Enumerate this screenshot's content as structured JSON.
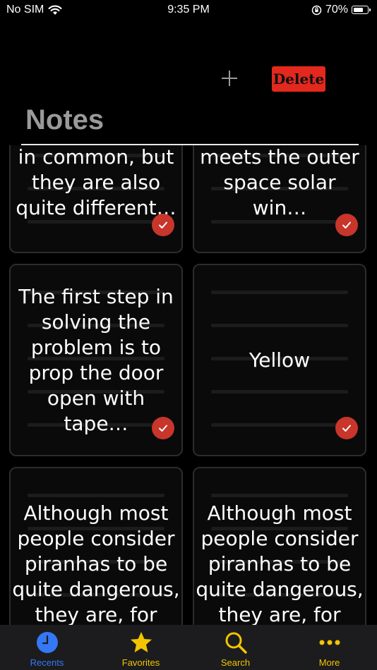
{
  "status_bar": {
    "carrier": "No SIM",
    "time": "9:35 PM",
    "battery_percent": "70%",
    "battery_level": 0.7
  },
  "header": {
    "title": "Notes",
    "delete_label": "Delete"
  },
  "notes": [
    {
      "text": "in common, but they are also quite different…",
      "checked": true
    },
    {
      "text": "when our sky meets the outer space solar win…",
      "checked": true
    },
    {
      "text": "The first step in solving the problem is to prop the door open with tape…",
      "checked": true
    },
    {
      "text": "Yellow",
      "checked": true
    },
    {
      "text": "Although most people consider piranhas to be quite dangerous, they are, for th…",
      "checked": false
    },
    {
      "text": "Although most people consider piranhas to be quite dangerous, they are, for th…",
      "checked": false
    }
  ],
  "tabs": [
    {
      "label": "Recents",
      "icon": "clock-icon",
      "active": true
    },
    {
      "label": "Favorites",
      "icon": "star-icon",
      "active": false
    },
    {
      "label": "Search",
      "icon": "search-icon",
      "active": false
    },
    {
      "label": "More",
      "icon": "more-icon",
      "active": false
    }
  ],
  "colors": {
    "accent_blue": "#3478f6",
    "accent_yellow": "#f2c500",
    "delete_red": "#e3281d",
    "check_red": "#c8352b"
  }
}
